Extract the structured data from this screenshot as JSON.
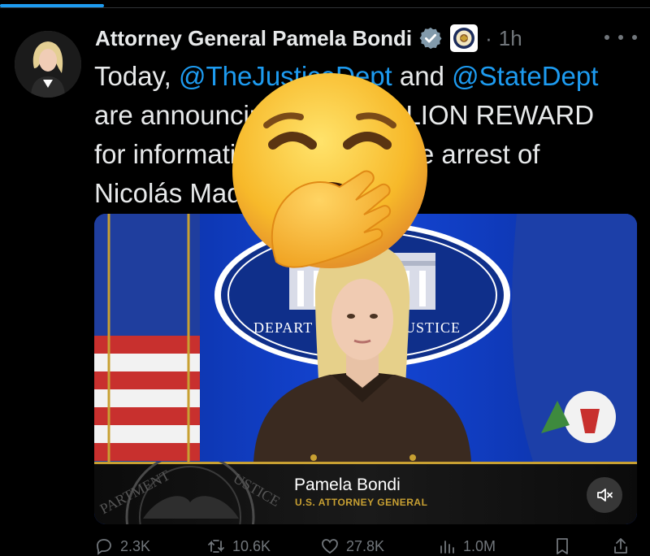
{
  "tweet": {
    "author_name": "Attorney General Pamela Bondi",
    "separator": "·",
    "time": "1h",
    "text_lines": [
      {
        "before": "Today, ",
        "mention1": "@TheJusticeDept",
        "middle": " and ",
        "mention2": "@StateDept"
      },
      {
        "text": "are announcing a $50 MILLION REWARD"
      },
      {
        "text": "for information leading to the arrest of"
      },
      {
        "text": "Nicolás Maduro."
      }
    ]
  },
  "video": {
    "caption_name": "Pamela Bondi",
    "caption_title": "U.S. ATTORNEY GENERAL",
    "backdrop_text_left": "DEPARTMENT",
    "backdrop_text_right": "JUSTICE",
    "seal_text_left": "PARTMENT",
    "seal_text_right": "USTICE",
    "mute_icon": "speaker-muted-icon"
  },
  "actions": [
    {
      "name": "reply",
      "count": "2.3K",
      "icon": "reply-icon"
    },
    {
      "name": "repost",
      "count": "10.6K",
      "icon": "repost-icon"
    },
    {
      "name": "like",
      "count": "27.8K",
      "icon": "heart-icon"
    },
    {
      "name": "views",
      "count": "1.0M",
      "icon": "views-icon"
    },
    {
      "name": "bookmark",
      "count": "",
      "icon": "bookmark-icon"
    },
    {
      "name": "share",
      "count": "",
      "icon": "share-icon"
    }
  ],
  "colors": {
    "background": "#000000",
    "text": "#e7e9ea",
    "muted": "#71767b",
    "link": "#1d9bf0",
    "caption_gold": "#c8a032"
  },
  "overlay_icon": "yawning-face-emoji"
}
